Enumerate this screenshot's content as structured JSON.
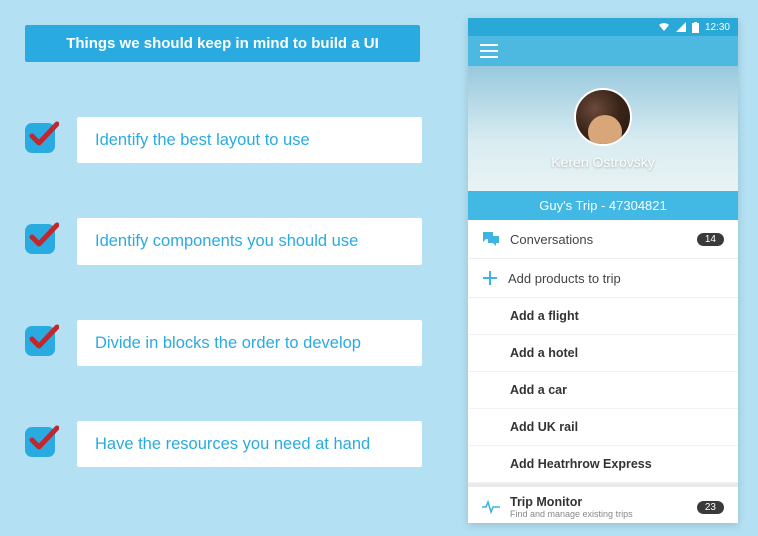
{
  "title": "Things we should keep in mind to build a UI",
  "bullets": [
    "Identify the best layout to use",
    "Identify components you should use",
    "Divide in blocks the order to develop",
    "Have the resources you need at hand"
  ],
  "phone": {
    "status": {
      "time": "12:30"
    },
    "profile": {
      "name": "Keren Ostrovsky"
    },
    "trip_bar": "Guy's Trip - 47304821",
    "menu": {
      "conversations": {
        "label": "Conversations",
        "badge": "14"
      },
      "add_products": {
        "label": "Add products to trip"
      },
      "subitems": [
        "Add a flight",
        "Add a hotel",
        "Add a car",
        "Add UK rail",
        "Add Heatrhrow Express"
      ],
      "trip_monitor": {
        "title": "Trip Monitor",
        "subtitle": "Find and manage existing trips",
        "badge": "23"
      }
    }
  }
}
